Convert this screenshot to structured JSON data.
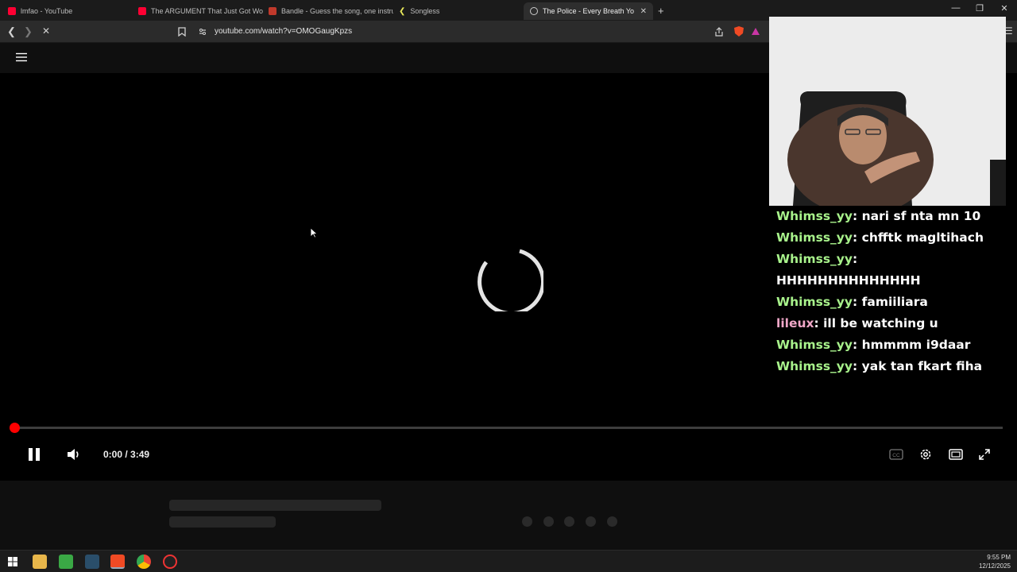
{
  "browser": {
    "tabs": [
      {
        "label": "lmfao - YouTube",
        "color": "#ff0033"
      },
      {
        "label": "The ARGUMENT That Just Got Worse",
        "color": "#ff0033"
      },
      {
        "label": "Bandle - Guess the song, one instrum",
        "color": "#c0392b"
      },
      {
        "label": "Songless",
        "color": "#e8e85a"
      },
      {
        "label": "The Police - Every Breath You Tal",
        "color": "#cccccc",
        "active": true
      }
    ],
    "new_tab": "+",
    "close_tab": "✕",
    "url": "youtube.com/watch?v=OMOGaugKpzs",
    "window_controls": {
      "minimize": "—",
      "maximize": "❐",
      "close": "✕"
    }
  },
  "player": {
    "time": "0:00 / 3:49",
    "progress_fraction": 0.0,
    "state": "loading"
  },
  "chat": [
    {
      "user": "Whimss_yy",
      "text": "nari sf nta mn 10"
    },
    {
      "user": "Whimss_yy",
      "text": "chfftk magltihach"
    },
    {
      "user": "Whimss_yy",
      "text": ""
    },
    {
      "user": "",
      "text": "HHHHHHHHHHHHHH"
    },
    {
      "user": "Whimss_yy",
      "text": "famiiliara"
    },
    {
      "user": "lileux",
      "text": "ill be watching u",
      "pink": true
    },
    {
      "user": "Whimss_yy",
      "text": "hmmmm i9daar"
    },
    {
      "user": "Whimss_yy",
      "text": "yak tan fkart fiha"
    }
  ],
  "taskbar": {
    "time": "9:55 PM",
    "date": "12/12/2025"
  },
  "colors": {
    "accent_red": "#ff0000",
    "chat_user": "#a8f28b",
    "chat_user_alt": "#f0a7c8"
  }
}
